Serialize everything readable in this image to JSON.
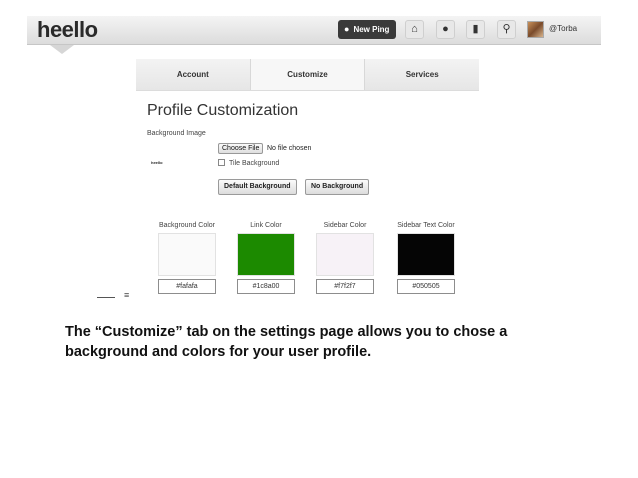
{
  "header": {
    "logo": "heello",
    "new_ping": "New Ping",
    "username": "@Torba",
    "icons": [
      "home-icon",
      "person-icon",
      "chat-icon",
      "search-icon"
    ]
  },
  "tabs": [
    {
      "label": "Account",
      "active": false
    },
    {
      "label": "Customize",
      "active": true
    },
    {
      "label": "Services",
      "active": false
    }
  ],
  "page": {
    "title": "Profile Customization",
    "background_label": "Background Image",
    "choose_file": "Choose File",
    "no_file": "No file chosen",
    "thumb_text": "heello",
    "tile_label": "Tile Background",
    "tile_checked": false,
    "default_bg_button": "Default Background",
    "no_bg_button": "No Background"
  },
  "colors": [
    {
      "label": "Background Color",
      "hex": "#fafafa"
    },
    {
      "label": "Link Color",
      "hex": "#1c8a00"
    },
    {
      "label": "Sidebar Color",
      "hex": "#f7f2f7"
    },
    {
      "label": "Sidebar Text Color",
      "hex": "#050505"
    }
  ],
  "caption": "The “Customize” tab on the settings page allows you to chose a background and colors for your user profile."
}
